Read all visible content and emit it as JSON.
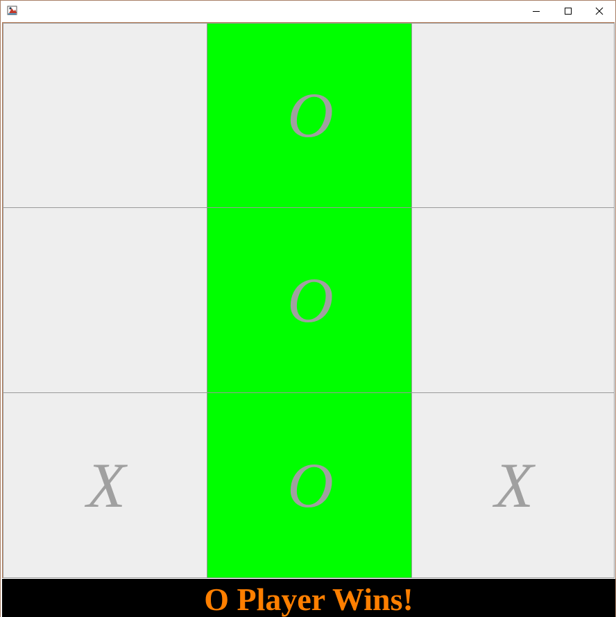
{
  "window": {
    "title": "",
    "icon": "java-app-icon",
    "controls": [
      "minimize",
      "maximize",
      "close"
    ]
  },
  "board": {
    "cells": [
      {
        "mark": "",
        "winning": false
      },
      {
        "mark": "O",
        "winning": true
      },
      {
        "mark": "",
        "winning": false
      },
      {
        "mark": "",
        "winning": false
      },
      {
        "mark": "O",
        "winning": true
      },
      {
        "mark": "",
        "winning": false
      },
      {
        "mark": "X",
        "winning": false
      },
      {
        "mark": "O",
        "winning": true
      },
      {
        "mark": "X",
        "winning": false
      }
    ],
    "colors": {
      "empty": "#eeeeee",
      "winning": "#00ff00",
      "mark": "#a0a0a0"
    }
  },
  "status": {
    "text": "O Player Wins!",
    "color": "#ff7f00",
    "background": "#000000"
  }
}
